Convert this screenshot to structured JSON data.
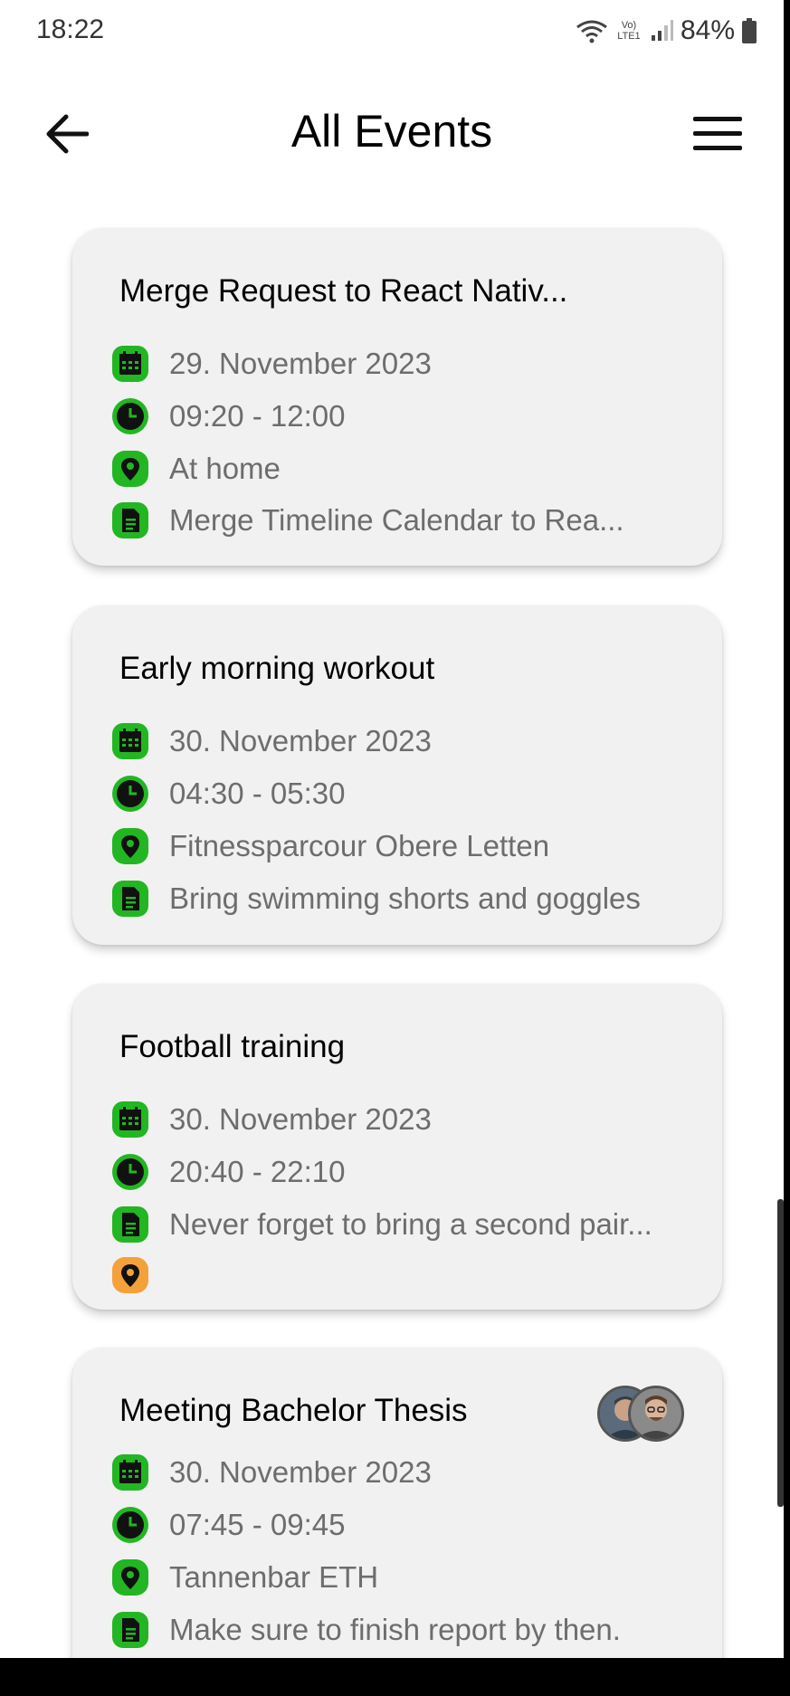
{
  "status": {
    "time": "18:22",
    "battery": "84%",
    "network": "Vo) LTE1"
  },
  "appbar": {
    "title": "All Events",
    "back_icon": "arrow-left-icon",
    "menu_icon": "hamburger-menu-icon"
  },
  "colors": {
    "icon_green": "#22b622",
    "icon_orange": "#f5a13a",
    "card_bg": "#f1f1f1"
  },
  "events": [
    {
      "title": "Merge Request to React Nativ...",
      "date": "29. November 2023",
      "time": "09:20 - 12:00",
      "location": "At home",
      "note": "Merge Timeline Calendar to Rea..."
    },
    {
      "title": "Early morning workout",
      "date": "30. November 2023",
      "time": "04:30 - 05:30",
      "location": "Fitnessparcour Obere Letten",
      "note": "Bring swimming shorts and goggles"
    },
    {
      "title": "Football training",
      "date": "30. November 2023",
      "time": "20:40 - 22:10",
      "note": "Never forget to bring a second pair..."
    },
    {
      "title": "Meeting Bachelor Thesis",
      "date": "30. November 2023",
      "time": "07:45 - 09:45",
      "location": "Tannenbar ETH",
      "note": "Make sure to finish report by then."
    }
  ]
}
